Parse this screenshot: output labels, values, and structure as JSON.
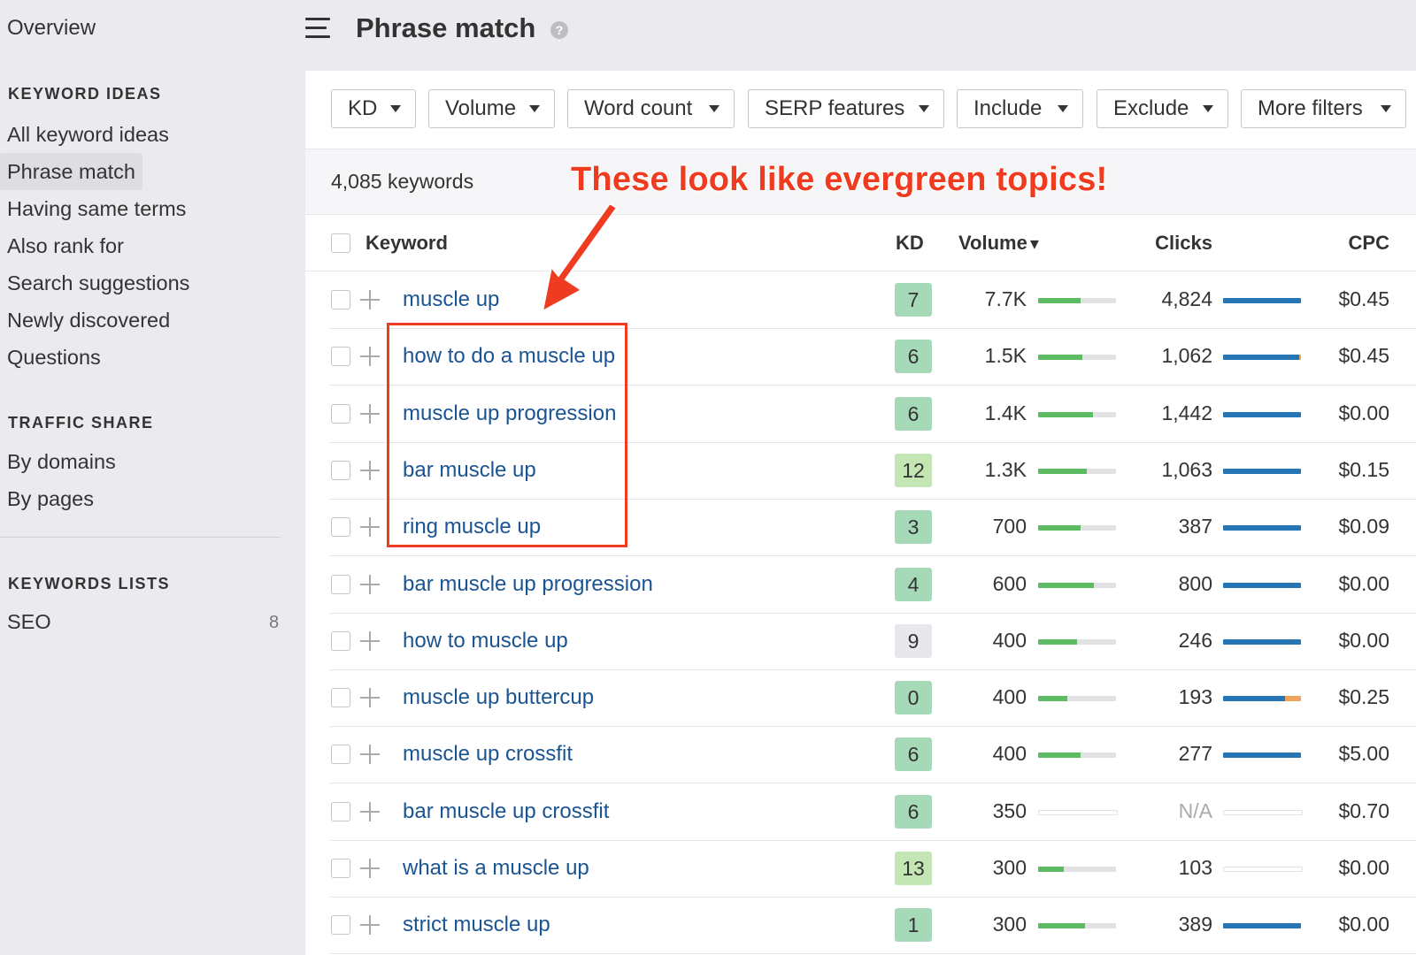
{
  "sidebar": {
    "overview": "Overview",
    "keyword_ideas": {
      "heading": "KEYWORD IDEAS",
      "items": [
        "All keyword ideas",
        "Phrase match",
        "Having same terms",
        "Also rank for",
        "Search suggestions",
        "Newly discovered",
        "Questions"
      ],
      "active_index": 1
    },
    "traffic_share": {
      "heading": "TRAFFIC SHARE",
      "items": [
        "By domains",
        "By pages"
      ]
    },
    "keywords_lists": {
      "heading": "KEYWORDS LISTS",
      "items": [
        {
          "label": "SEO",
          "count": "8"
        }
      ]
    }
  },
  "header": {
    "menu_icon": "hamburger-icon",
    "title": "Phrase match",
    "help_icon": "?"
  },
  "filters": [
    "KD",
    "Volume",
    "Word count",
    "SERP features",
    "Include",
    "Exclude",
    "More filters"
  ],
  "summary": {
    "keyword_count": "4,085 keywords",
    "annotation": "These look like evergreen topics!"
  },
  "table": {
    "headers": {
      "keyword": "Keyword",
      "kd": "KD",
      "volume": "Volume",
      "clicks": "Clicks",
      "cpc": "CPC"
    },
    "sort_indicator": "▾",
    "rows": [
      {
        "keyword": "muscle up",
        "kd": "7",
        "volume": "7.7K",
        "volume_bar": 0.55,
        "clicks": "4,824",
        "clicks_bar": 1.0,
        "clicks_alt": 0,
        "cpc": "$0.45"
      },
      {
        "keyword": "how to do a muscle up",
        "kd": "6",
        "volume": "1.5K",
        "volume_bar": 0.57,
        "clicks": "1,062",
        "clicks_bar": 0.98,
        "clicks_alt": 0.02,
        "cpc": "$0.45"
      },
      {
        "keyword": "muscle up progression",
        "kd": "6",
        "volume": "1.4K",
        "volume_bar": 0.7,
        "clicks": "1,442",
        "clicks_bar": 1.0,
        "clicks_alt": 0,
        "cpc": "$0.00"
      },
      {
        "keyword": "bar muscle up",
        "kd": "12",
        "volume": "1.3K",
        "volume_bar": 0.62,
        "clicks": "1,063",
        "clicks_bar": 1.0,
        "clicks_alt": 0,
        "cpc": "$0.15"
      },
      {
        "keyword": "ring muscle up",
        "kd": "3",
        "volume": "700",
        "volume_bar": 0.55,
        "clicks": "387",
        "clicks_bar": 1.0,
        "clicks_alt": 0,
        "cpc": "$0.09"
      },
      {
        "keyword": "bar muscle up progression",
        "kd": "4",
        "volume": "600",
        "volume_bar": 0.72,
        "clicks": "800",
        "clicks_bar": 1.0,
        "clicks_alt": 0,
        "cpc": "$0.00"
      },
      {
        "keyword": "how to muscle up",
        "kd": "9",
        "volume": "400",
        "volume_bar": 0.5,
        "clicks": "246",
        "clicks_bar": 1.0,
        "clicks_alt": 0,
        "cpc": "$0.00"
      },
      {
        "keyword": "muscle up buttercup",
        "kd": "0",
        "volume": "400",
        "volume_bar": 0.38,
        "clicks": "193",
        "clicks_bar": 0.8,
        "clicks_alt": 0.2,
        "cpc": "$0.25"
      },
      {
        "keyword": "muscle up crossfit",
        "kd": "6",
        "volume": "400",
        "volume_bar": 0.55,
        "clicks": "277",
        "clicks_bar": 1.0,
        "clicks_alt": 0,
        "cpc": "$5.00"
      },
      {
        "keyword": "bar muscle up crossfit",
        "kd": "6",
        "volume": "350",
        "volume_bar": 0,
        "clicks": "N/A",
        "clicks_bar": 0,
        "clicks_alt": 0,
        "cpc": "$0.70"
      },
      {
        "keyword": "what is a muscle up",
        "kd": "13",
        "volume": "300",
        "volume_bar": 0.33,
        "clicks": "103",
        "clicks_bar": 0,
        "clicks_alt": 0,
        "cpc": "$0.00"
      },
      {
        "keyword": "strict muscle up",
        "kd": "1",
        "volume": "300",
        "volume_bar": 0.6,
        "clicks": "389",
        "clicks_bar": 1.0,
        "clicks_alt": 0,
        "cpc": "$0.00"
      }
    ]
  },
  "colors": {
    "link": "#1a5492",
    "kd_green": "#a6d9b8",
    "kd_light_green": "#c3e6b4",
    "kd_gray": "#e8e8ec",
    "volume_bar": "#5dbb63",
    "clicks_bar": "#2676b6",
    "clicks_alt_bar": "#f0a35a",
    "annotation": "#ef3b1f"
  }
}
